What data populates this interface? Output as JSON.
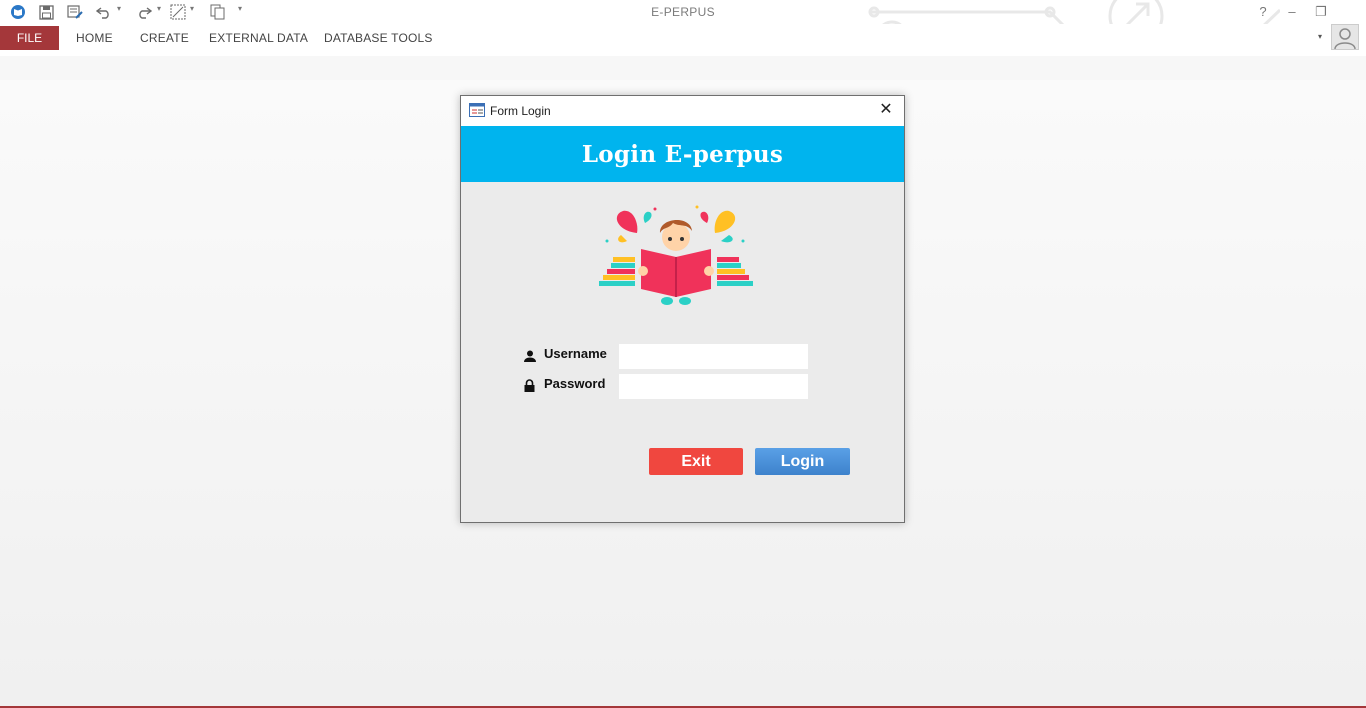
{
  "titlebar": {
    "app_title": "E-PERPUS",
    "help_glyph": "?",
    "minimize_glyph": "–",
    "restore_glyph": "❐",
    "qat_icons": [
      "access-app-icon",
      "save-icon",
      "form-view-icon",
      "undo-icon",
      "redo-icon",
      "chart-icon",
      "copy-icon",
      "customize-qat-icon"
    ]
  },
  "ribbon": {
    "tabs": [
      "FILE",
      "HOME",
      "CREATE",
      "EXTERNAL DATA",
      "DATABASE TOOLS"
    ],
    "file_tab_color": "#a4373a"
  },
  "dialog": {
    "title": "Form Login",
    "close_glyph": "✕",
    "heading": "Login E-perpus",
    "header_color": "#00b4ee",
    "username_label": "Username",
    "password_label": "Password",
    "username_value": "",
    "password_value": "",
    "exit_label": "Exit",
    "login_label": "Login",
    "exit_color": "#f0473f",
    "login_color": "#4a90d9"
  }
}
